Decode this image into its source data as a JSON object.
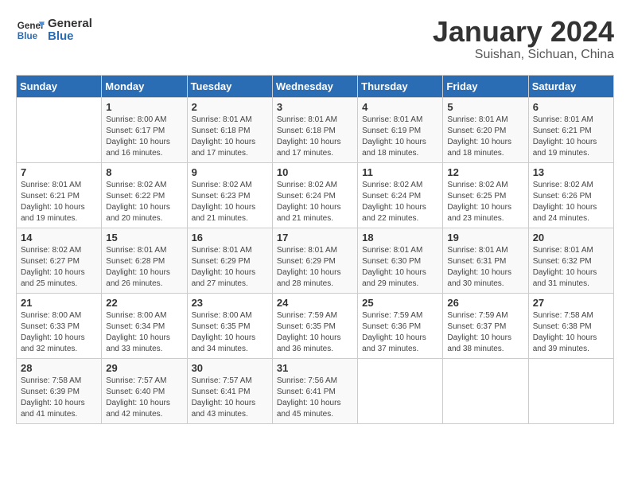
{
  "logo": {
    "line1": "General",
    "line2": "Blue"
  },
  "title": "January 2024",
  "subtitle": "Suishan, Sichuan, China",
  "days_of_week": [
    "Sunday",
    "Monday",
    "Tuesday",
    "Wednesday",
    "Thursday",
    "Friday",
    "Saturday"
  ],
  "weeks": [
    [
      {
        "day": "",
        "info": ""
      },
      {
        "day": "1",
        "info": "Sunrise: 8:00 AM\nSunset: 6:17 PM\nDaylight: 10 hours\nand 16 minutes."
      },
      {
        "day": "2",
        "info": "Sunrise: 8:01 AM\nSunset: 6:18 PM\nDaylight: 10 hours\nand 17 minutes."
      },
      {
        "day": "3",
        "info": "Sunrise: 8:01 AM\nSunset: 6:18 PM\nDaylight: 10 hours\nand 17 minutes."
      },
      {
        "day": "4",
        "info": "Sunrise: 8:01 AM\nSunset: 6:19 PM\nDaylight: 10 hours\nand 18 minutes."
      },
      {
        "day": "5",
        "info": "Sunrise: 8:01 AM\nSunset: 6:20 PM\nDaylight: 10 hours\nand 18 minutes."
      },
      {
        "day": "6",
        "info": "Sunrise: 8:01 AM\nSunset: 6:21 PM\nDaylight: 10 hours\nand 19 minutes."
      }
    ],
    [
      {
        "day": "7",
        "info": "Sunrise: 8:01 AM\nSunset: 6:21 PM\nDaylight: 10 hours\nand 19 minutes."
      },
      {
        "day": "8",
        "info": "Sunrise: 8:02 AM\nSunset: 6:22 PM\nDaylight: 10 hours\nand 20 minutes."
      },
      {
        "day": "9",
        "info": "Sunrise: 8:02 AM\nSunset: 6:23 PM\nDaylight: 10 hours\nand 21 minutes."
      },
      {
        "day": "10",
        "info": "Sunrise: 8:02 AM\nSunset: 6:24 PM\nDaylight: 10 hours\nand 21 minutes."
      },
      {
        "day": "11",
        "info": "Sunrise: 8:02 AM\nSunset: 6:24 PM\nDaylight: 10 hours\nand 22 minutes."
      },
      {
        "day": "12",
        "info": "Sunrise: 8:02 AM\nSunset: 6:25 PM\nDaylight: 10 hours\nand 23 minutes."
      },
      {
        "day": "13",
        "info": "Sunrise: 8:02 AM\nSunset: 6:26 PM\nDaylight: 10 hours\nand 24 minutes."
      }
    ],
    [
      {
        "day": "14",
        "info": "Sunrise: 8:02 AM\nSunset: 6:27 PM\nDaylight: 10 hours\nand 25 minutes."
      },
      {
        "day": "15",
        "info": "Sunrise: 8:01 AM\nSunset: 6:28 PM\nDaylight: 10 hours\nand 26 minutes."
      },
      {
        "day": "16",
        "info": "Sunrise: 8:01 AM\nSunset: 6:29 PM\nDaylight: 10 hours\nand 27 minutes."
      },
      {
        "day": "17",
        "info": "Sunrise: 8:01 AM\nSunset: 6:29 PM\nDaylight: 10 hours\nand 28 minutes."
      },
      {
        "day": "18",
        "info": "Sunrise: 8:01 AM\nSunset: 6:30 PM\nDaylight: 10 hours\nand 29 minutes."
      },
      {
        "day": "19",
        "info": "Sunrise: 8:01 AM\nSunset: 6:31 PM\nDaylight: 10 hours\nand 30 minutes."
      },
      {
        "day": "20",
        "info": "Sunrise: 8:01 AM\nSunset: 6:32 PM\nDaylight: 10 hours\nand 31 minutes."
      }
    ],
    [
      {
        "day": "21",
        "info": "Sunrise: 8:00 AM\nSunset: 6:33 PM\nDaylight: 10 hours\nand 32 minutes."
      },
      {
        "day": "22",
        "info": "Sunrise: 8:00 AM\nSunset: 6:34 PM\nDaylight: 10 hours\nand 33 minutes."
      },
      {
        "day": "23",
        "info": "Sunrise: 8:00 AM\nSunset: 6:35 PM\nDaylight: 10 hours\nand 34 minutes."
      },
      {
        "day": "24",
        "info": "Sunrise: 7:59 AM\nSunset: 6:35 PM\nDaylight: 10 hours\nand 36 minutes."
      },
      {
        "day": "25",
        "info": "Sunrise: 7:59 AM\nSunset: 6:36 PM\nDaylight: 10 hours\nand 37 minutes."
      },
      {
        "day": "26",
        "info": "Sunrise: 7:59 AM\nSunset: 6:37 PM\nDaylight: 10 hours\nand 38 minutes."
      },
      {
        "day": "27",
        "info": "Sunrise: 7:58 AM\nSunset: 6:38 PM\nDaylight: 10 hours\nand 39 minutes."
      }
    ],
    [
      {
        "day": "28",
        "info": "Sunrise: 7:58 AM\nSunset: 6:39 PM\nDaylight: 10 hours\nand 41 minutes."
      },
      {
        "day": "29",
        "info": "Sunrise: 7:57 AM\nSunset: 6:40 PM\nDaylight: 10 hours\nand 42 minutes."
      },
      {
        "day": "30",
        "info": "Sunrise: 7:57 AM\nSunset: 6:41 PM\nDaylight: 10 hours\nand 43 minutes."
      },
      {
        "day": "31",
        "info": "Sunrise: 7:56 AM\nSunset: 6:41 PM\nDaylight: 10 hours\nand 45 minutes."
      },
      {
        "day": "",
        "info": ""
      },
      {
        "day": "",
        "info": ""
      },
      {
        "day": "",
        "info": ""
      }
    ]
  ]
}
